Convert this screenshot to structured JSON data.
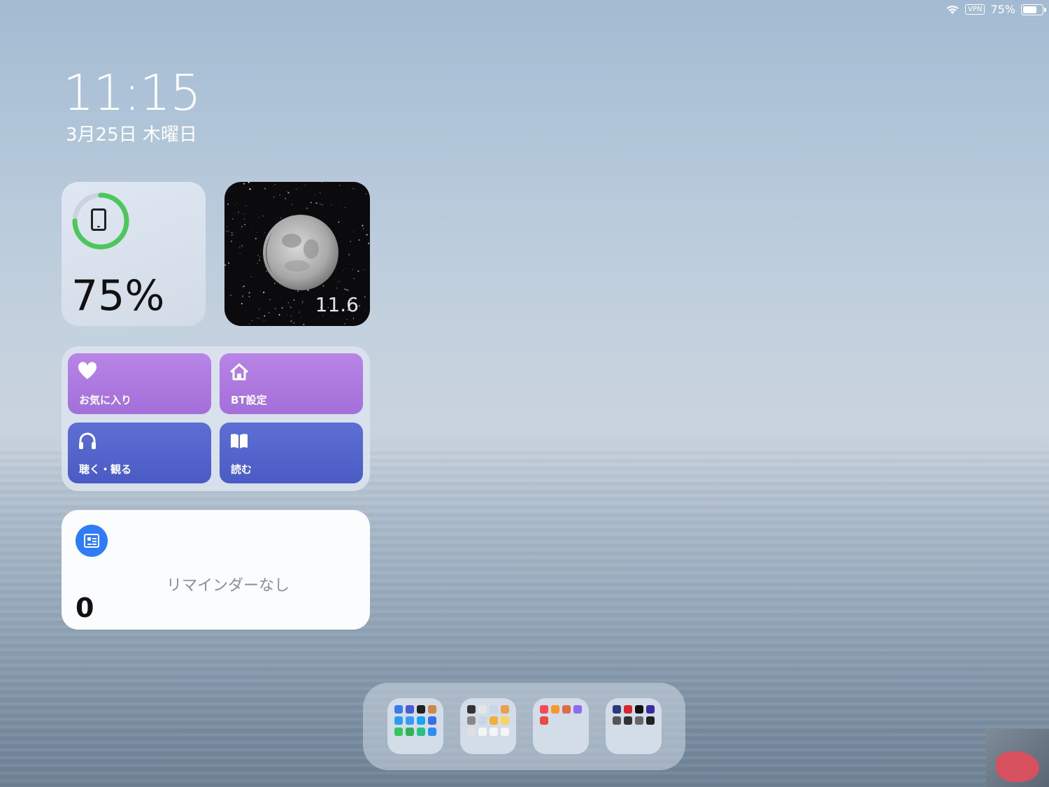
{
  "status_bar": {
    "vpn": "VPN",
    "battery_text": "75%",
    "battery_level": 0.75
  },
  "lock": {
    "time": "11:15",
    "date": "3月25日 木曜日"
  },
  "battery_widget": {
    "percent_text": "75%",
    "level": 0.75,
    "ring_color": "#4cc85a"
  },
  "moon_widget": {
    "age": "11.6"
  },
  "shortcuts": [
    {
      "label": "お気に入り",
      "icon": "heart-icon",
      "color": "purple"
    },
    {
      "label": "BT設定",
      "icon": "home-icon",
      "color": "purple"
    },
    {
      "label": "聴く・観る",
      "icon": "headphones-icon",
      "color": "blue"
    },
    {
      "label": "読む",
      "icon": "book-icon",
      "color": "blue"
    }
  ],
  "reminders": {
    "empty_text": "リマインダーなし",
    "count": "0",
    "accent": "#2e7cf6"
  },
  "dock": {
    "folders": [
      {
        "icons": [
          "#3b7de8",
          "#4a5bd6",
          "#222",
          "#c98a4a",
          "#2e9af0",
          "#3b9af5",
          "#1da1f2",
          "#3a6ee8",
          "#34c759",
          "#2fb35a",
          "#26c281",
          "#2f8ef5"
        ]
      },
      {
        "icons": [
          "#333",
          "#e5e5e5",
          "#c8d6e8",
          "#e9a24a",
          "#888",
          "#c8d6e8",
          "#f0b13a",
          "#f7d560",
          "#e0e0e0",
          "#f5f5f5",
          "#f5f5f5",
          "#f5f5f5"
        ]
      },
      {
        "icons": [
          "#f54a58",
          "#f59a2a",
          "#e06a4a",
          "#8a6cf0",
          "#e94b3c"
        ]
      },
      {
        "icons": [
          "#2a3a7a",
          "#d8262e",
          "#111",
          "#3a2a9a",
          "#555",
          "#333",
          "#666",
          "#222"
        ]
      }
    ]
  }
}
